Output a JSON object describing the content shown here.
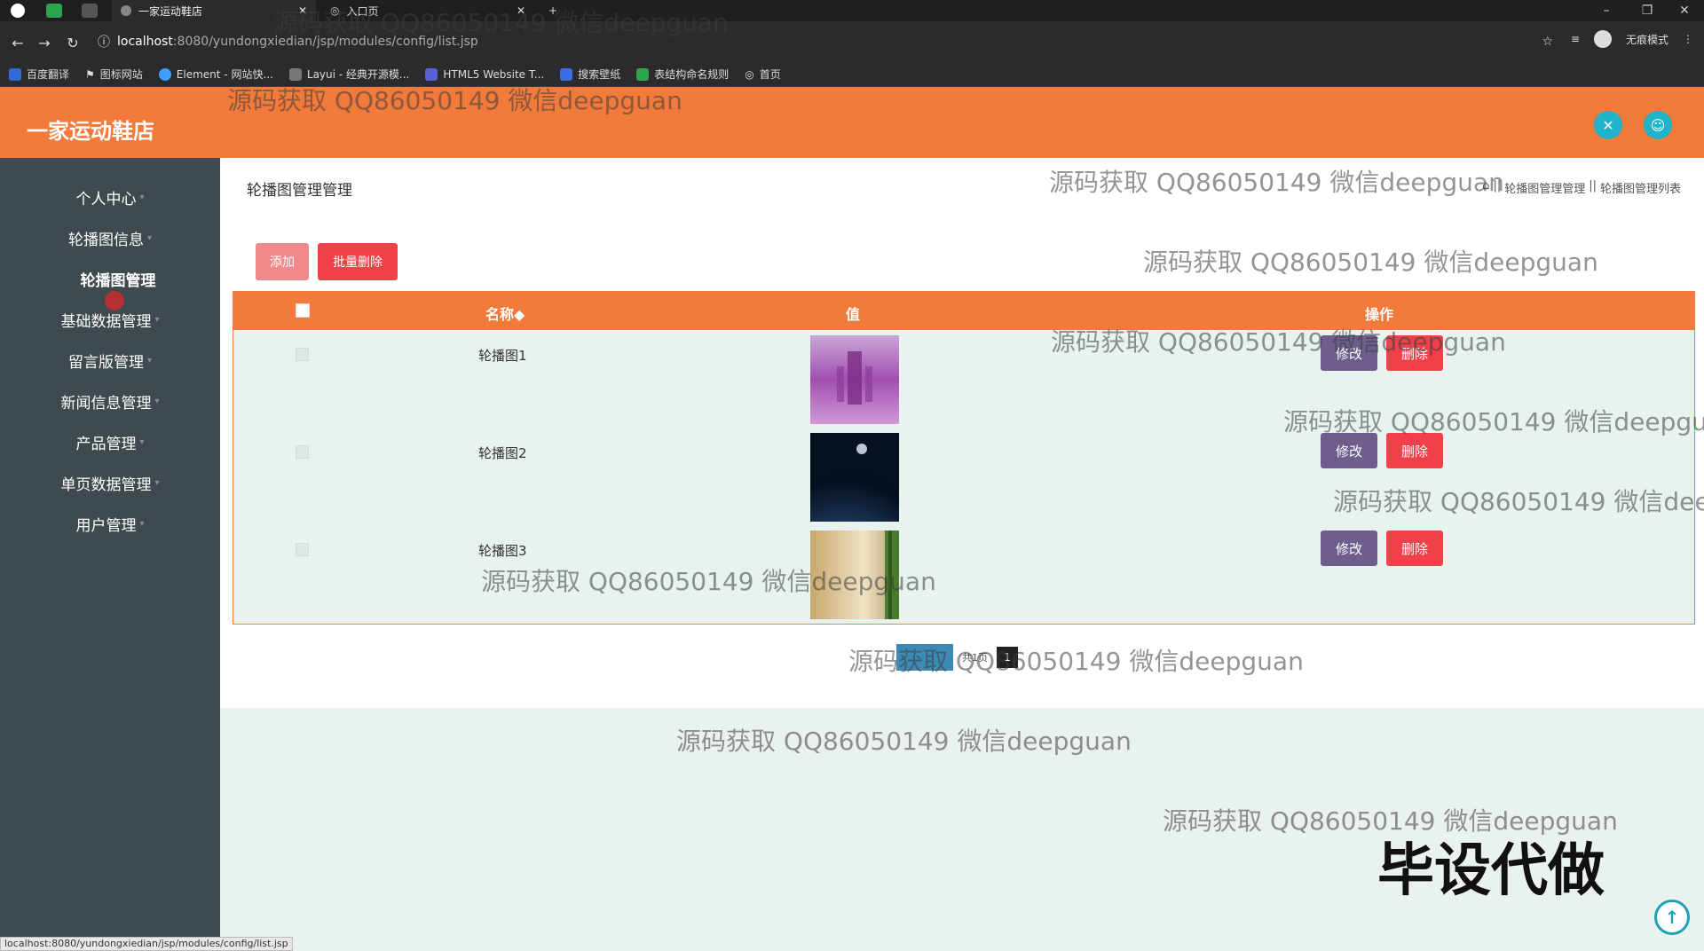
{
  "browser": {
    "tabs": [
      {
        "label": "一家运动鞋店"
      },
      {
        "label": "入口页"
      }
    ],
    "new_tab_glyph": "+",
    "url_host": "localhost",
    "url_path": ":8080/yundongxiedian/jsp/modules/config/list.jsp",
    "profile_label": "无痕模式",
    "bookmarks": [
      {
        "label": "百度翻译",
        "color": "#2f6bd8"
      },
      {
        "label": "图标网站",
        "color": "#ffffff"
      },
      {
        "label": "Element - 网站快...",
        "color": "#409eff"
      },
      {
        "label": "Layui - 经典开源模...",
        "color": "#cccccc"
      },
      {
        "label": "HTML5 Website T...",
        "color": "#5a5fd6"
      },
      {
        "label": "搜索壁纸",
        "color": "#3a6de0"
      },
      {
        "label": "表结构命名规则",
        "color": "#2da44e"
      },
      {
        "label": "首页",
        "color": "#dddddd"
      }
    ]
  },
  "header": {
    "brand": "一家运动鞋店",
    "accent_color": "#f27a3a",
    "icons": [
      "fullscreen-icon",
      "user-icon"
    ]
  },
  "sidebar": {
    "items": [
      {
        "label": "个人中心"
      },
      {
        "label": "轮播图信息"
      },
      {
        "label": "轮播图管理",
        "active": true
      },
      {
        "label": "基础数据管理"
      },
      {
        "label": "留言版管理"
      },
      {
        "label": "新闻信息管理"
      },
      {
        "label": "产品管理"
      },
      {
        "label": "单页数据管理"
      },
      {
        "label": "用户管理"
      }
    ]
  },
  "main": {
    "title": "轮播图管理管理",
    "breadcrumb": [
      "轮播图管理管理",
      "轮播图管理列表"
    ],
    "add_label": "添加",
    "batch_delete_label": "批量删除",
    "columns": {
      "name": "名称◆",
      "value": "值",
      "actions": "操作"
    },
    "rows": [
      {
        "name": "轮播图1",
        "edit": "修改",
        "delete": "删除"
      },
      {
        "name": "轮播图2",
        "edit": "修改",
        "delete": "删除"
      },
      {
        "name": "轮播图3",
        "edit": "修改",
        "delete": "删除"
      }
    ],
    "pager": {
      "total_text": "共1页",
      "current": "1"
    }
  },
  "watermarks": {
    "text": "源码获取 QQ86050149 微信deepguan",
    "big": "毕设代做"
  },
  "status_bar_url": "localhost:8080/yundongxiedian/jsp/modules/config/list.jsp"
}
